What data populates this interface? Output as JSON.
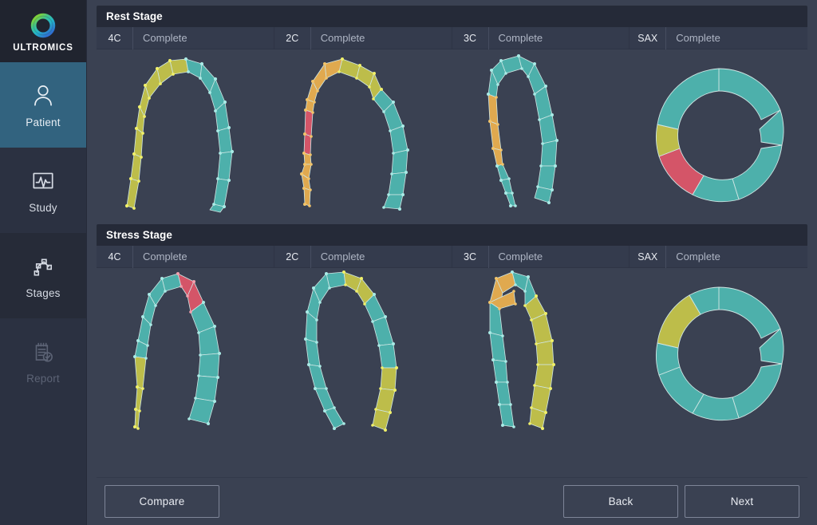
{
  "brand": {
    "name": "ULTROMICS",
    "logo_icon": "ultromics-ring-logo"
  },
  "sidebar": {
    "items": [
      {
        "label": "Patient",
        "icon": "person-icon",
        "state": "active"
      },
      {
        "label": "Study",
        "icon": "waveform-monitor-icon",
        "state": "default"
      },
      {
        "label": "Stages",
        "icon": "node-graph-icon",
        "state": "current"
      },
      {
        "label": "Report",
        "icon": "report-check-icon",
        "state": "disabled"
      }
    ]
  },
  "colors": {
    "background": "#3a4152",
    "panel_header": "#252a38",
    "row": "#343b4d",
    "accent_active": "#32637f",
    "segment_teal": "#4db0ab",
    "segment_yellow": "#bdbd4a",
    "segment_orange": "#e0a94f",
    "segment_red": "#d45568"
  },
  "stages": [
    {
      "title": "Rest Stage",
      "views": [
        {
          "code": "4C",
          "status": "Complete"
        },
        {
          "code": "2C",
          "status": "Complete"
        },
        {
          "code": "3C",
          "status": "Complete"
        },
        {
          "code": "SAX",
          "status": "Complete"
        }
      ]
    },
    {
      "title": "Stress Stage",
      "views": [
        {
          "code": "4C",
          "status": "Complete"
        },
        {
          "code": "2C",
          "status": "Complete"
        },
        {
          "code": "3C",
          "status": "Complete"
        },
        {
          "code": "SAX",
          "status": "Complete"
        }
      ]
    }
  ],
  "footer": {
    "compare_label": "Compare",
    "back_label": "Back",
    "next_label": "Next"
  }
}
